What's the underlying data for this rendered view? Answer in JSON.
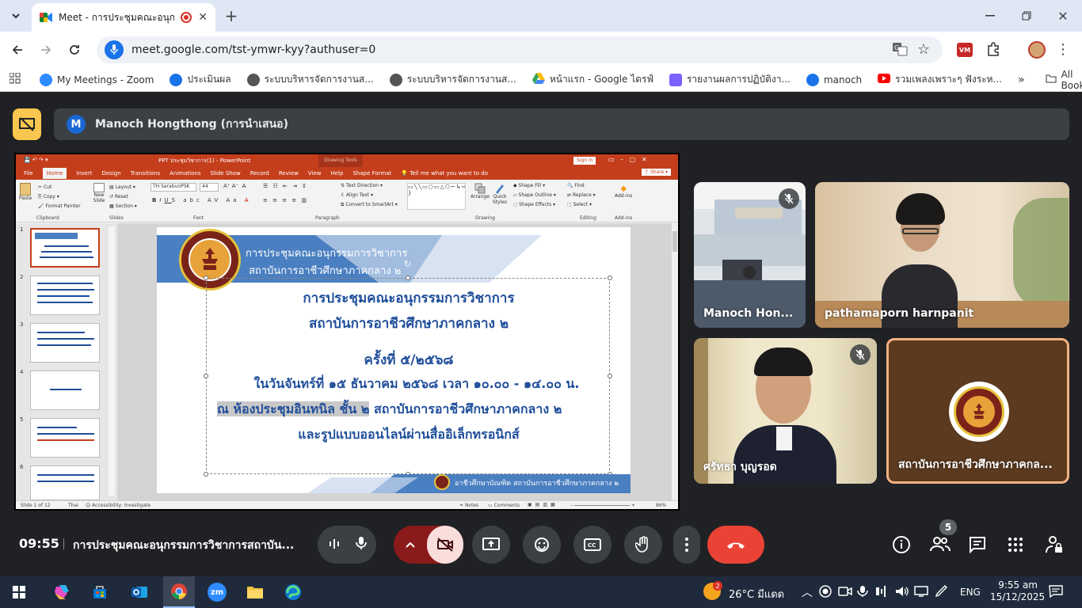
{
  "browser": {
    "tab_title": "Meet - การประชุมคณะอนุกรรม",
    "url": "meet.google.com/tst-ymwr-kyy?authuser=0",
    "bookmarks": [
      {
        "label": "My Meetings - Zoom",
        "color": "#2d8cff"
      },
      {
        "label": "ประเมินผล",
        "color": "#1a73e8"
      },
      {
        "label": "ระบบบริหารจัดการงานส...",
        "color": "#555555"
      },
      {
        "label": "ระบบบริหารจัดการงานส...",
        "color": "#555555"
      },
      {
        "label": "หน้าแรก - Google ไดรฟ์",
        "color": "#34a853"
      },
      {
        "label": "รายงานผลการปฏิบัติงา...",
        "color": "#7b61ff"
      },
      {
        "label": "manoch",
        "color": "#1a73e8"
      },
      {
        "label": "รวมเพลงเพราะๆ ฟังระห...",
        "color": "#ff0000"
      }
    ],
    "all_bookmarks": "All Bookmarks"
  },
  "meet": {
    "presenter_initial": "M",
    "presenter_label": "Manoch Hongthong (การนำเสนอ)",
    "participants": [
      {
        "name": "Manoch Hon...",
        "muted": true
      },
      {
        "name": "pathamaporn harnpanit",
        "muted": false
      },
      {
        "name": "ศรัทธา บุญรอด",
        "muted": true
      },
      {
        "name": "สถาบันการอาชีวศึกษาภาคกล...",
        "muted": false
      }
    ],
    "time": "09:55",
    "meeting_title": "การประชุมคณะอนุกรรมการวิชาการสถาบัน...",
    "people_count": "5"
  },
  "ppt": {
    "window_title": "PPT ประชุมวิชาการ(1)  -  PowerPoint",
    "drawing_tools": "Drawing Tools",
    "sign_in": "Sign in",
    "tabs": [
      "File",
      "Home",
      "Insert",
      "Design",
      "Transitions",
      "Animations",
      "Slide Show",
      "Record",
      "Review",
      "View",
      "Help",
      "Shape Format"
    ],
    "tell_me": "Tell me what you want to do",
    "share": "Share",
    "ribbon": {
      "paste": "Paste",
      "cut": "Cut",
      "copy": "Copy",
      "format_painter": "Format Painter",
      "clipboard": "Clipboard",
      "new_slide": "New Slide",
      "layout": "Layout",
      "reset": "Reset",
      "section": "Section",
      "slides": "Slides",
      "font_name": "TH SarabunPSK",
      "font_size": "44",
      "font": "Font",
      "text_direction": "Text Direction",
      "align_text": "Align Text",
      "convert_smartart": "Convert to SmartArt",
      "paragraph": "Paragraph",
      "arrange": "Arrange",
      "quick_styles": "Quick Styles",
      "shape_fill": "Shape Fill",
      "shape_outline": "Shape Outline",
      "shape_effects": "Shape Effects",
      "drawing": "Drawing",
      "find": "Find",
      "replace": "Replace",
      "select": "Select",
      "editing": "Editing",
      "addins": "Add-ins"
    },
    "slide_numbers": [
      "1",
      "2",
      "3",
      "4",
      "5",
      "6"
    ],
    "slide": {
      "header_line1": "การประชุมคณะอนุกรรมการวิชาการ",
      "header_line2": "สถาบันการอาชีวศึกษาภาคกลาง ๒",
      "line1": "การประชุมคณะอนุกรรมการวิชาการ",
      "line2": "สถาบันการอาชีวศึกษาภาคกลาง ๒",
      "line3": "ครั้งที่ ๕/๒๕๖๘",
      "line4": "ในวันจันทร์ที่ ๑๕ ธันวาคม ๒๕๖๘ เวลา ๑๐.๐๐ - ๑๔.๐๐ น.",
      "line5a": "ณ ห้องประชุมอินทนิล ชั้น ๒",
      "line5b": " สถาบันการอาชีวศึกษาภาคกลาง ๒",
      "line6": "และรูปแบบออนไลน์ผ่านสื่ออิเล็กทรอนิกส์",
      "footer": "อาชีวศึกษาบัณฑิต สถาบันการอาชีวศึกษาภาคกลาง ๒"
    },
    "status": {
      "slide_of": "Slide 1 of 12",
      "lang": "Thai",
      "accessibility": "Accessibility: Investigate",
      "notes": "Notes",
      "comments": "Comments",
      "zoom": "86%"
    }
  },
  "taskbar": {
    "weather_badge": "2",
    "weather": "26°C  มีแดด",
    "lang": "ENG",
    "clock_time": "9:55 am",
    "clock_date": "15/12/2025"
  }
}
